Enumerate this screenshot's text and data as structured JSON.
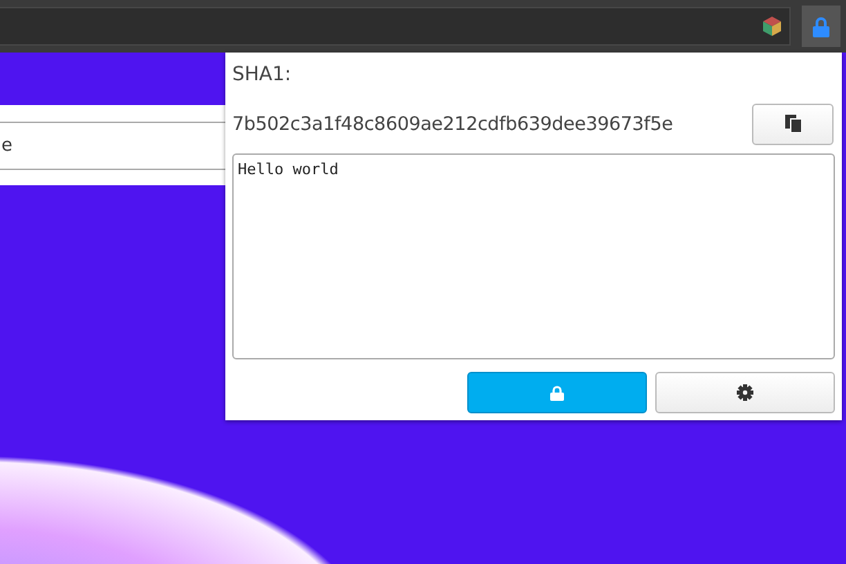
{
  "page": {
    "panel_text": "e"
  },
  "popup": {
    "label": "SHA1:",
    "hash": "7b502c3a1f48c8609ae212cdfb639dee39673f5e",
    "input": {
      "value": "Hello world"
    }
  }
}
